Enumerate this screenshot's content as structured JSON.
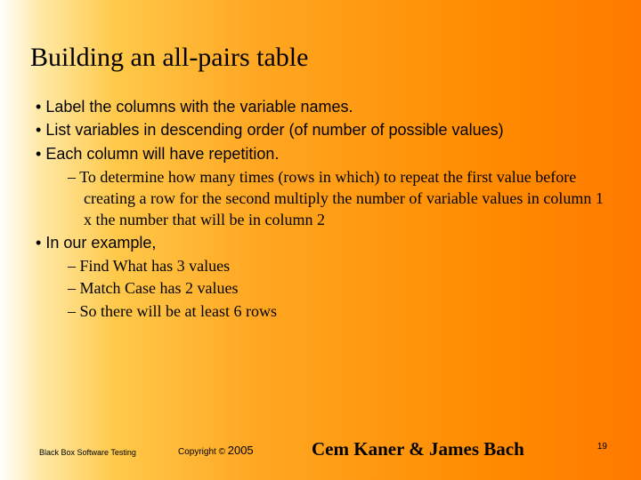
{
  "title": "Building an all-pairs table",
  "bullets": {
    "b1": "Label the columns with the variable names.",
    "b2": "List variables in descending order (of number of possible values)",
    "b3": "Each column will have repetition.",
    "b3a": "To determine how many times (rows in which) to repeat the first value before creating a row for the second multiply the number of variable values in column 1 x the number that will be in column 2",
    "b4": "In our example,",
    "b4a": "Find What has 3 values",
    "b4b": "Match Case has 2 values",
    "b4c": "So there will be at least 6 rows"
  },
  "footer": {
    "left": "Black Box Software Testing",
    "copy_label": "Copyright ©",
    "copy_year": "2005",
    "authors": "Cem Kaner & James Bach",
    "page": "19"
  }
}
